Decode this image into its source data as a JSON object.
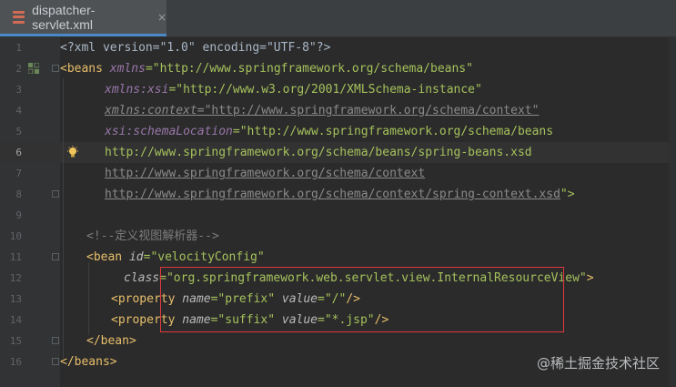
{
  "tab": {
    "title": "dispatcher-servlet.xml",
    "close_glyph": "×"
  },
  "line_numbers": [
    "1",
    "2",
    "3",
    "4",
    "5",
    "6",
    "7",
    "8",
    "9",
    "10",
    "11",
    "12",
    "13",
    "14",
    "15",
    "16"
  ],
  "code": {
    "l1": {
      "text": "<?xml version=\"1.0\" encoding=\"UTF-8\"?>"
    },
    "l2": {
      "tag": "<beans",
      "attr": "xmlns",
      "val": "=\"http://www.springframework.org/schema/beans\""
    },
    "l3": {
      "attr": "xmlns:xsi",
      "val": "=\"http://www.w3.org/2001/XMLSchema-instance\""
    },
    "l4": {
      "attr": "xmlns:context",
      "val": "=\"http://www.springframework.org/schema/context\""
    },
    "l5": {
      "attr": "xsi:schemaLocation",
      "val": "=\"http://www.springframework.org/schema/beans"
    },
    "l6": {
      "val": "http://www.springframework.org/schema/beans/spring-beans.xsd"
    },
    "l7": {
      "val": "http://www.springframework.org/schema/context"
    },
    "l8": {
      "val": "http://www.springframework.org/schema/context/spring-context.xsd",
      "end": "\">"
    },
    "l10": {
      "comment": "<!--定义视图解析器-->"
    },
    "l11": {
      "tag": "<bean",
      "attr": "id",
      "val": "=\"velocityConfig\""
    },
    "l12": {
      "attr": "class",
      "val": "=\"org.springframework.web.servlet.view.InternalResourceView\"",
      "end": ">"
    },
    "l13": {
      "tag": "<property",
      "attr1": "name",
      "val1": "=\"prefix\"",
      "attr2": "value",
      "val2": "=\"/\"",
      "end": "/>"
    },
    "l14": {
      "tag": "<property",
      "attr1": "name",
      "val1": "=\"suffix\"",
      "attr2": "value",
      "val2": "=\"*.jsp\"",
      "end": "/>"
    },
    "l15": {
      "text": "</bean>"
    },
    "l16": {
      "text": "</beans>"
    }
  },
  "watermark": "@稀土掘金技术社区",
  "colors": {
    "tag": "#e8bf6a",
    "value": "#a5c25c",
    "namespace": "#9876aa",
    "highlight_box": "#e0383e"
  }
}
